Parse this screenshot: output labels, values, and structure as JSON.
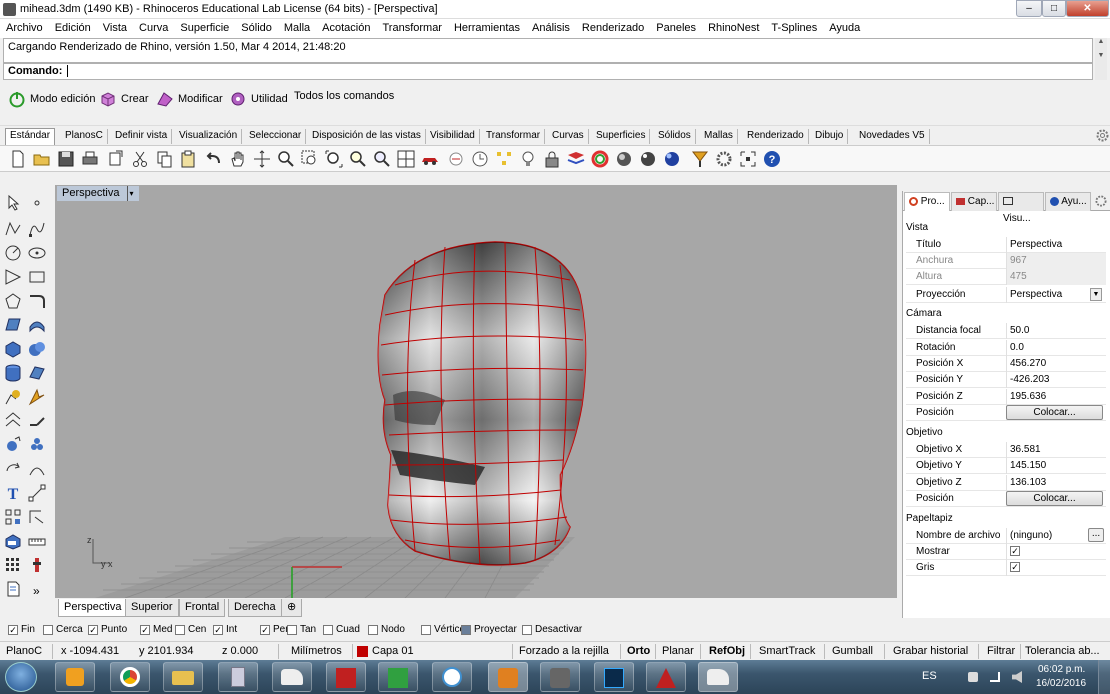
{
  "title_bar": {
    "title": "mihead.3dm (1490 KB) - Rhinoceros Educational Lab License (64 bits) - [Perspectiva]"
  },
  "menu": [
    "Archivo",
    "Edición",
    "Vista",
    "Curva",
    "Superficie",
    "Sólido",
    "Malla",
    "Acotación",
    "Transformar",
    "Herramientas",
    "Análisis",
    "Renderizado",
    "Paneles",
    "RhinoNest",
    "T-Splines",
    "Ayuda"
  ],
  "command_history": "Cargando Renderizado de Rhino, versión 1.50, Mar  4 2014, 21:48:20",
  "command_prompt": "Comando:",
  "mode_bar": [
    "Modo edición",
    "Crear",
    "Modificar",
    "Utilidad",
    "Todos los comandos"
  ],
  "toolbar_tabs": [
    "Estándar",
    "PlanosC",
    "Definir vista",
    "Visualización",
    "Seleccionar",
    "Disposición de las vistas",
    "Visibilidad",
    "Transformar",
    "Curvas",
    "Superficies",
    "Sólidos",
    "Mallas",
    "Renderizado",
    "Dibujo",
    "Novedades V5"
  ],
  "viewport": {
    "title": "Perspectiva",
    "axis_z": "z",
    "axis_yx": "y x"
  },
  "viewport_tabs": [
    "Perspectiva",
    "Superior",
    "Frontal",
    "Derecha"
  ],
  "panel_tabs": [
    "Pro...",
    "Cap...",
    "Visu...",
    "Ayu..."
  ],
  "properties": {
    "vista_header": "Vista",
    "titulo_k": "Título",
    "titulo_v": "Perspectiva",
    "anchura_k": "Anchura",
    "anchura_v": "967",
    "altura_k": "Altura",
    "altura_v": "475",
    "proyeccion_k": "Proyección",
    "proyeccion_v": "Perspectiva",
    "camara_header": "Cámara",
    "focal_k": "Distancia focal",
    "focal_v": "50.0",
    "rot_k": "Rotación",
    "rot_v": "0.0",
    "px_k": "Posición X",
    "px_v": "456.270",
    "py_k": "Posición Y",
    "py_v": "-426.203",
    "pz_k": "Posición Z",
    "pz_v": "195.636",
    "pos_k": "Posición",
    "colocar": "Colocar...",
    "objetivo_header": "Objetivo",
    "ox_k": "Objetivo X",
    "ox_v": "36.581",
    "oy_k": "Objetivo Y",
    "oy_v": "145.150",
    "oz_k": "Objetivo Z",
    "oz_v": "136.103",
    "papel_header": "Papeltapiz",
    "archivo_k": "Nombre de archivo",
    "archivo_v": "(ninguno)",
    "mostrar_k": "Mostrar",
    "gris_k": "Gris"
  },
  "osnaps": [
    {
      "label": "Fin",
      "checked": true
    },
    {
      "label": "Cerca",
      "checked": false
    },
    {
      "label": "Punto",
      "checked": true
    },
    {
      "label": "Med",
      "checked": true
    },
    {
      "label": "Cen",
      "checked": false
    },
    {
      "label": "Int",
      "checked": true
    },
    {
      "label": "Perp",
      "checked": true
    },
    {
      "label": "Tan",
      "checked": false
    },
    {
      "label": "Cuad",
      "checked": false
    },
    {
      "label": "Nodo",
      "checked": false
    },
    {
      "label": "Vértice",
      "checked": false
    },
    {
      "label": "Proyectar",
      "checked": false
    },
    {
      "label": "Desactivar",
      "checked": false
    }
  ],
  "status": {
    "plane": "PlanoC",
    "x": "x -1094.431",
    "y": "y 2101.934",
    "z": "z 0.000",
    "units": "Milímetros",
    "layer": "Capa 01",
    "grid": "Forzado a la rejilla",
    "orto": "Orto",
    "planar": "Planar",
    "refobj": "RefObj",
    "smarttrack": "SmartTrack",
    "gumball": "Gumball",
    "history": "Grabar historial",
    "filter": "Filtrar",
    "tolerance": "Tolerancia ab..."
  },
  "taskbar": {
    "lang": "ES",
    "time": "06:02 p.m.",
    "date": "16/02/2016"
  },
  "colors": {
    "accent": "#c00000",
    "layer": "#c00000",
    "viewport_bg": "#a7a7a7"
  }
}
